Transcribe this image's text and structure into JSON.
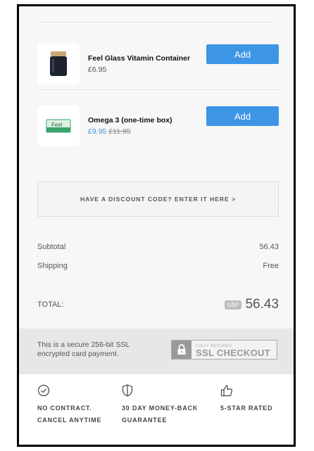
{
  "products": [
    {
      "name": "Feel Glass Vitamin Container",
      "price": "£6.95",
      "add_label": "Add",
      "thumb_icon": "glass-jar-icon"
    },
    {
      "name": "Omega 3 (one-time box)",
      "sale_price": "£9.95",
      "original_price": "£11.95",
      "add_label": "Add",
      "thumb_icon": "omega-box-icon",
      "box_brand": "Feel"
    }
  ],
  "discount": {
    "label": "HAVE A DISCOUNT CODE? ENTER IT HERE >"
  },
  "summary": {
    "subtotal_label": "Subtotal",
    "subtotal_value": "56.43",
    "shipping_label": "Shipping",
    "shipping_value": "Free",
    "total_label": "TOTAL:",
    "currency": "GBP",
    "total_value": "56.43"
  },
  "ssl": {
    "text": "This is a secure 256-bit SSL encrypted card payment.",
    "badge_small": "FULLY SECURED",
    "badge_big": "SSL CHECKOUT"
  },
  "features": [
    {
      "icon": "check-circle-icon",
      "text": "NO CONTRACT.\nCANCEL ANYTIME"
    },
    {
      "icon": "shield-icon",
      "text": "30 DAY MONEY-BACK\nGUARANTEE"
    },
    {
      "icon": "thumbs-up-icon",
      "text": "5-STAR RATED"
    }
  ],
  "colors": {
    "accent": "#3d95e6",
    "sale": "#4a90d9",
    "background": "#f7f7f7"
  }
}
